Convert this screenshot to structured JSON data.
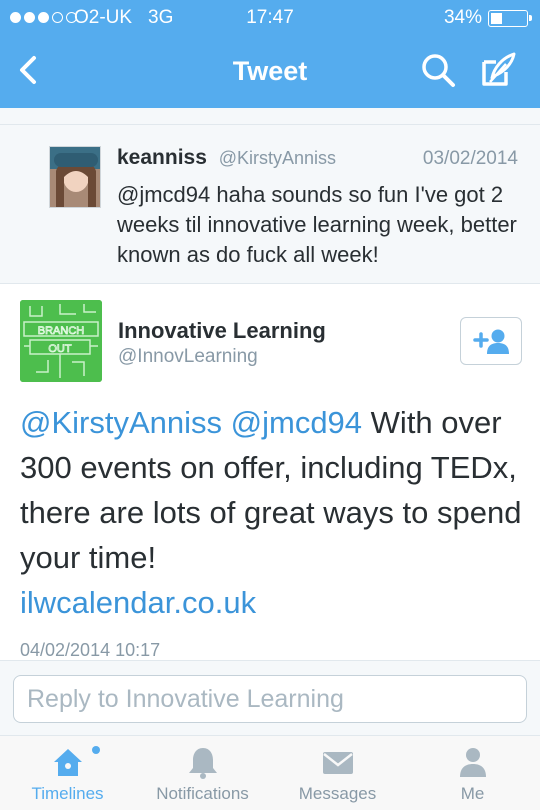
{
  "status_bar": {
    "carrier": "O2-UK",
    "network": "3G",
    "time": "17:47",
    "battery": "34%",
    "battery_level": 0.34,
    "signal_bars": 3
  },
  "nav": {
    "title": "Tweet",
    "back_icon": "chevron-left-icon",
    "search_icon": "search-icon",
    "compose_icon": "compose-icon"
  },
  "parent_tweet": {
    "name": "keanniss",
    "handle": "@KirstyAnniss",
    "date": "03/02/2014",
    "text": "@jmcd94 haha sounds so fun I've got 2 weeks til innovative learning week, better known as do fuck all week!"
  },
  "main_tweet": {
    "name": "Innovative Learning",
    "handle": "@InnovLearning",
    "logo_text_top": "BRANCH",
    "logo_text_bottom": "OUT",
    "mention_1": "@KirstyAnniss",
    "mention_2": "@jmcd94",
    "body": "With over 300 events on offer, including TEDx, there are lots of great ways to spend your time!",
    "link": "ilwcalendar.co.uk",
    "timestamp": "04/02/2014 10:17"
  },
  "reply": {
    "placeholder": "Reply to Innovative Learning"
  },
  "tabs": [
    {
      "label": "Timelines",
      "icon": "home-icon",
      "active": true
    },
    {
      "label": "Notifications",
      "icon": "bell-icon",
      "active": false
    },
    {
      "label": "Messages",
      "icon": "envelope-icon",
      "active": false
    },
    {
      "label": "Me",
      "icon": "person-icon",
      "active": false
    }
  ],
  "colors": {
    "brand": "#55acee",
    "link": "#3b94d9",
    "muted": "#8899a6",
    "logo_green": "#4dbe4d"
  }
}
